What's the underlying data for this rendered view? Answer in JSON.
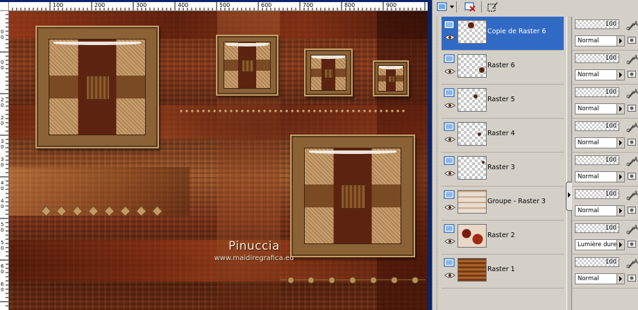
{
  "rulers": {
    "top_labels": [
      "100",
      "200",
      "300",
      "400",
      "500",
      "600",
      "700",
      "800",
      "900"
    ],
    "left_labels": [
      "0",
      "0",
      "0",
      "0",
      "2",
      "0",
      "2",
      "0",
      "3",
      "0",
      "3",
      "0",
      "4",
      "0",
      "4",
      "0",
      "5",
      "0",
      "5",
      "0",
      "6",
      "0",
      "6",
      "0"
    ]
  },
  "watermark": {
    "name": "Pinuccia",
    "url": "www.maidiregrafica.eu"
  },
  "layers_toolbar": {
    "icons": [
      "new-layer-icon",
      "dropdown-arrow-icon",
      "delete-layer-icon",
      "edit-selection-icon"
    ]
  },
  "layers": [
    {
      "name": "Copie de Raster 6",
      "selected": true,
      "opacity": "100",
      "blend": "Normal",
      "lock_partial": "A"
    },
    {
      "name": "Raster 6",
      "selected": false,
      "opacity": "100",
      "blend": "Normal",
      "lock_partial": "A"
    },
    {
      "name": "Raster 5",
      "selected": false,
      "opacity": "100",
      "blend": "Normal",
      "lock_partial": "A"
    },
    {
      "name": "Raster 4",
      "selected": false,
      "opacity": "100",
      "blend": "Normal",
      "lock_partial": "A"
    },
    {
      "name": "Raster 3",
      "selected": false,
      "opacity": "100",
      "blend": "Normal",
      "lock_partial": "A"
    },
    {
      "name": "Groupe - Raster 3",
      "selected": false,
      "opacity": "100",
      "blend": "Normal",
      "lock_partial": "A"
    },
    {
      "name": "Raster 2",
      "selected": false,
      "opacity": "100",
      "blend": "Lumière dure",
      "lock_partial": "A"
    },
    {
      "name": "Raster 1",
      "selected": false,
      "opacity": "100",
      "blend": "Normal",
      "lock_partial": "A"
    }
  ],
  "colors": {
    "selection": "#316ac5",
    "panel_bg": "#d4d0c8",
    "canvas_frame": "#0a246a"
  }
}
